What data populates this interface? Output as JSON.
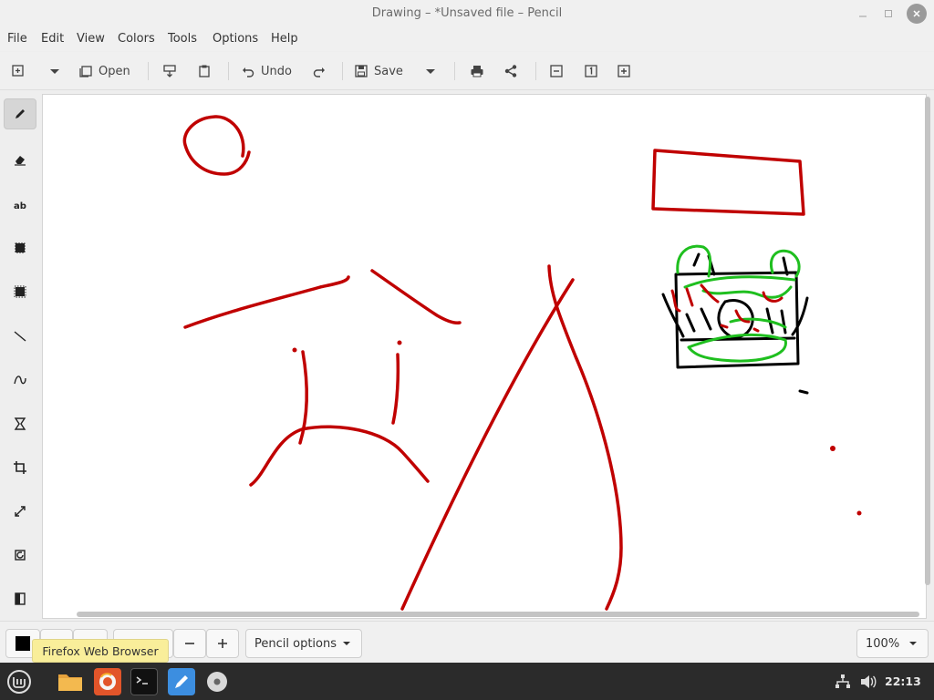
{
  "window": {
    "title": "Drawing – *Unsaved file – Pencil"
  },
  "menu": [
    "File",
    "Edit",
    "View",
    "Colors",
    "Tools",
    "Options",
    "Help"
  ],
  "toolbar": {
    "open_label": "Open",
    "undo_label": "Undo",
    "save_label": "Save"
  },
  "bottom": {
    "tool_options_label": "Pencil options",
    "zoom_value": "100%",
    "tooltip": "Firefox Web Browser"
  },
  "colors": {
    "stroke_red": "#c00000",
    "stroke_green": "#1fbf1f",
    "stroke_black": "#000000",
    "primary_color": "#000000"
  },
  "taskbar": {
    "clock": "22:13"
  }
}
